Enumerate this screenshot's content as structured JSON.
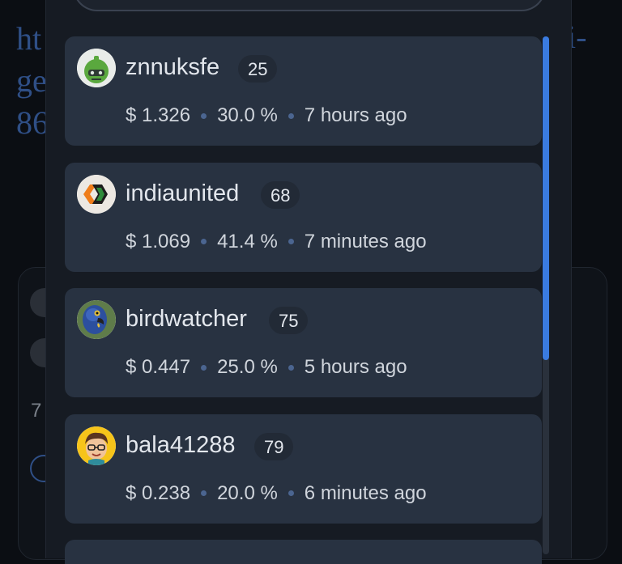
{
  "background": {
    "text_left_lines": [
      "ht",
      "ge",
      "86"
    ],
    "text_right": "i-",
    "count": "7"
  },
  "votes": [
    {
      "username": "znnuksfe",
      "reputation": "25",
      "value": "$ 1.326",
      "percent": "30.0 %",
      "time": "7 hours ago",
      "avatar": "robot-avatar"
    },
    {
      "username": "indiaunited",
      "reputation": "68",
      "value": "$ 1.069",
      "percent": "41.4 %",
      "time": "7 minutes ago",
      "avatar": "india-united-logo"
    },
    {
      "username": "birdwatcher",
      "reputation": "75",
      "value": "$ 0.447",
      "percent": "25.0 %",
      "time": "5 hours ago",
      "avatar": "parrot-avatar"
    },
    {
      "username": "bala41288",
      "reputation": "79",
      "value": "$ 0.238",
      "percent": "20.0 %",
      "time": "6 minutes ago",
      "avatar": "cartoon-person-avatar"
    }
  ],
  "colors": {
    "card": "#283241",
    "accent": "#3a7be0",
    "dot": "#4b6590"
  }
}
